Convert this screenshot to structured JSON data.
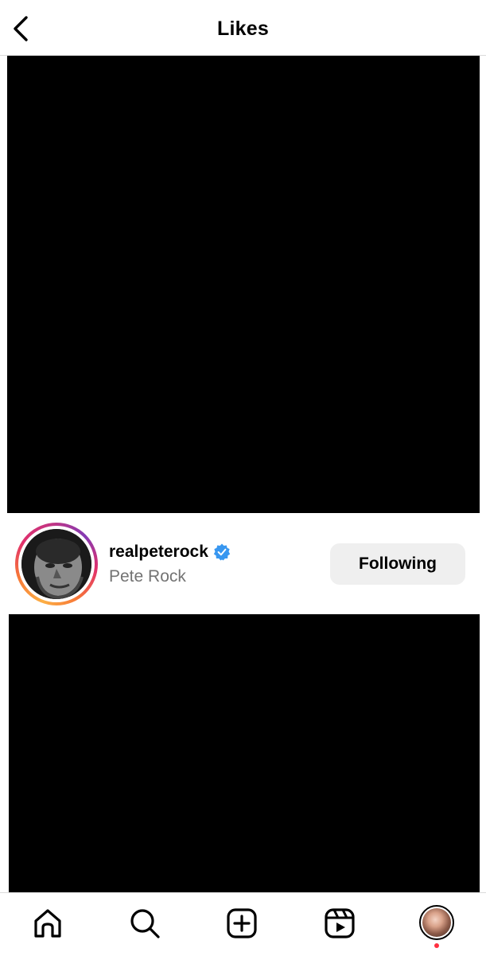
{
  "header": {
    "title": "Likes",
    "back_icon": "chevron-left-icon"
  },
  "user": {
    "username": "realpeterock",
    "full_name": "Pete Rock",
    "verified": true,
    "follow_label": "Following"
  },
  "nav": {
    "items": [
      "home-icon",
      "search-icon",
      "create-icon",
      "reels-icon",
      "profile-avatar"
    ]
  },
  "colors": {
    "verified": "#3897f0",
    "secondary_text": "#737373",
    "button_bg": "#efefef",
    "notification": "#ff3040"
  }
}
